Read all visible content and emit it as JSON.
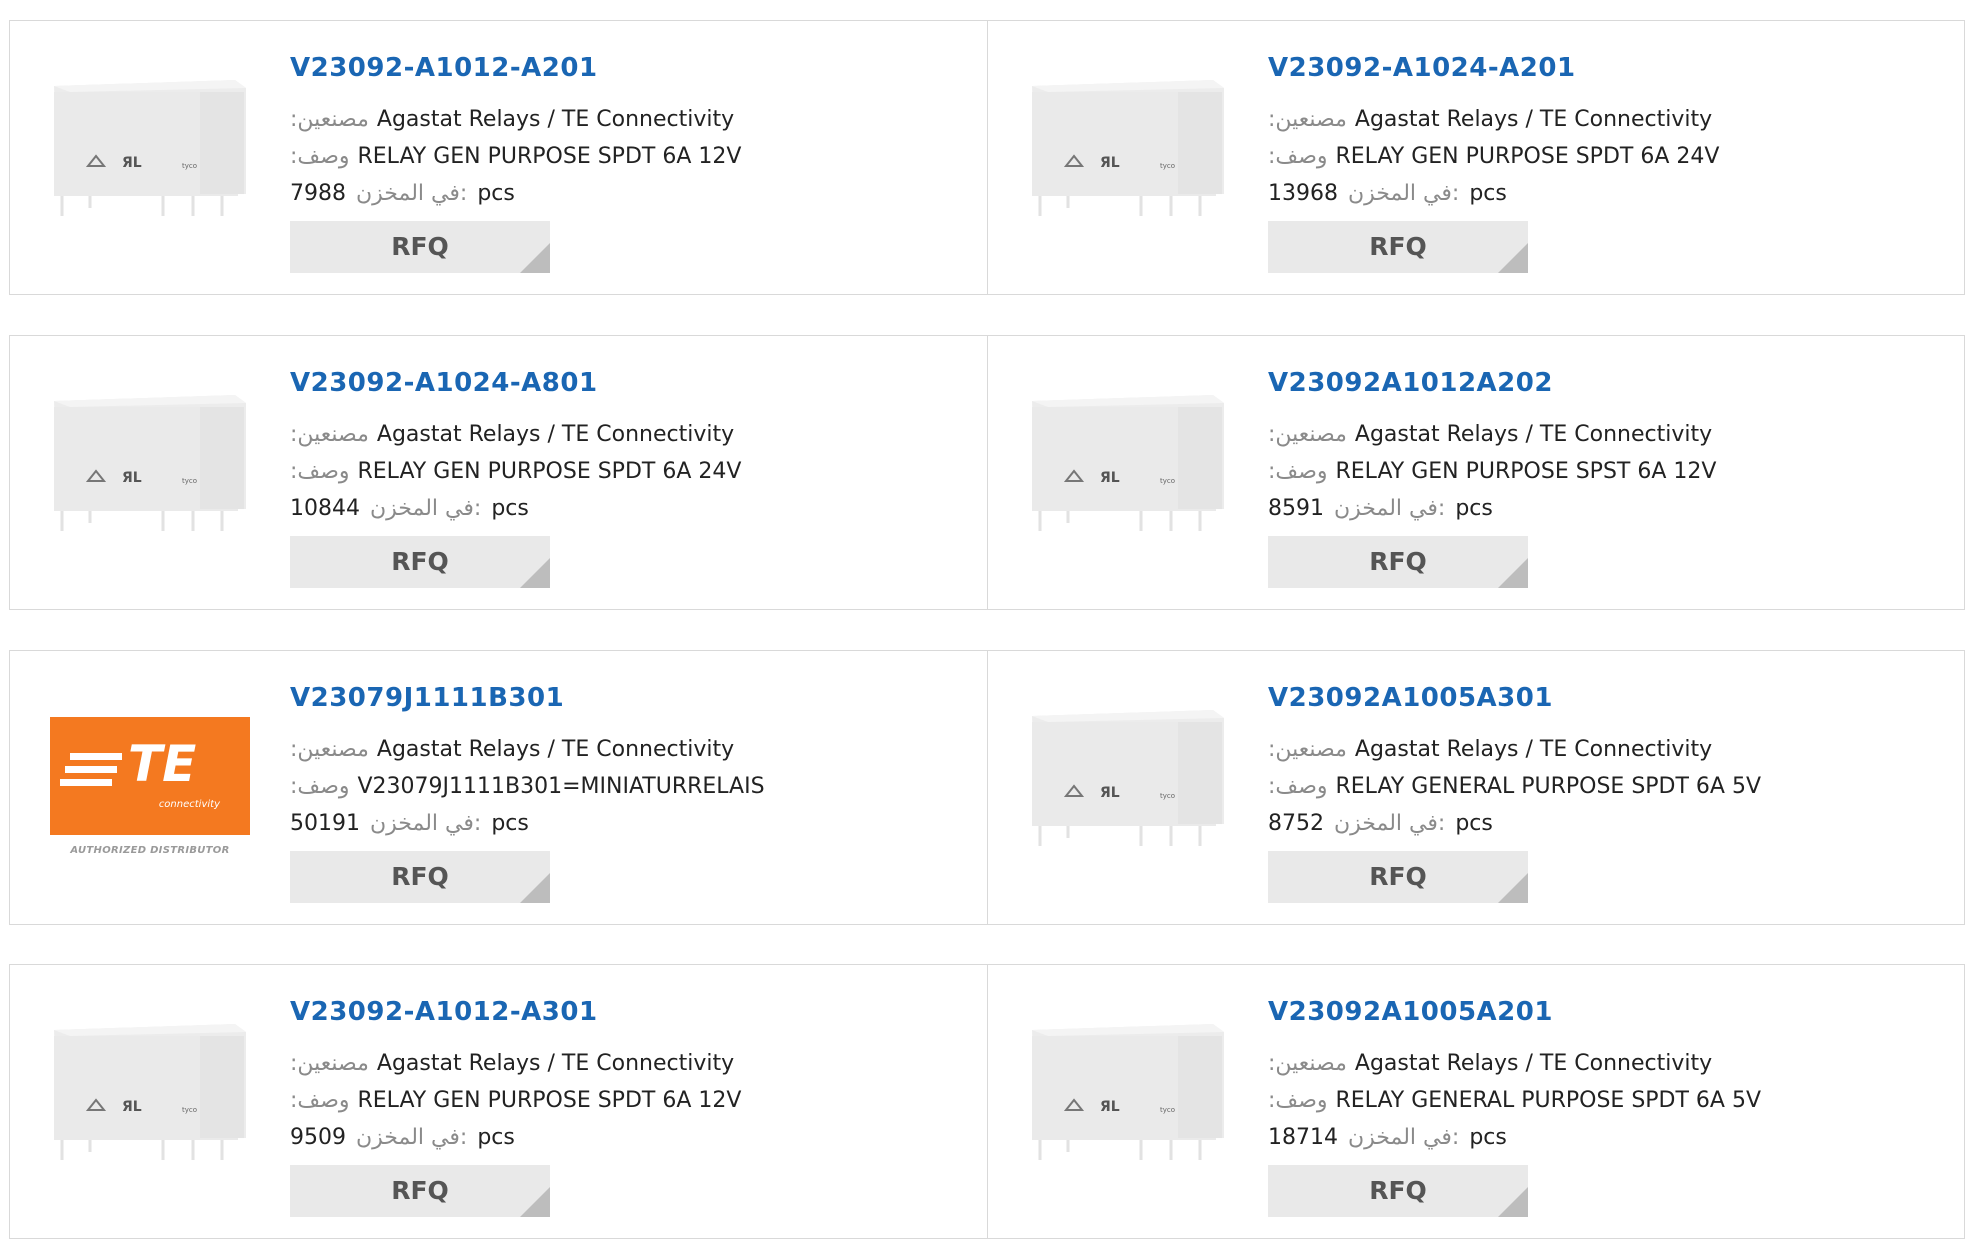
{
  "labels": {
    "manufacturer": ":مصنعين",
    "description": ":وصف",
    "in_stock": "في المخزن:",
    "pcs": "pcs",
    "rfq": "RFQ"
  },
  "te_logo": {
    "text": "TE",
    "sub": "connectivity",
    "tag": "AUTHORIZED DISTRIBUTOR"
  },
  "products": [
    {
      "part": "V23092-A1012-A201",
      "manufacturer": "Agastat Relays / TE Connectivity",
      "description": "RELAY GEN PURPOSE SPDT 6A 12V",
      "stock": "7988",
      "image": "relay"
    },
    {
      "part": "V23092-A1024-A201",
      "manufacturer": "Agastat Relays / TE Connectivity",
      "description": "RELAY GEN PURPOSE SPDT 6A 24V",
      "stock": "13968",
      "image": "relay"
    },
    {
      "part": "V23092-A1024-A801",
      "manufacturer": "Agastat Relays / TE Connectivity",
      "description": "RELAY GEN PURPOSE SPDT 6A 24V",
      "stock": "10844",
      "image": "relay"
    },
    {
      "part": "V23092A1012A202",
      "manufacturer": "Agastat Relays / TE Connectivity",
      "description": "RELAY GEN PURPOSE SPST 6A 12V",
      "stock": "8591",
      "image": "relay"
    },
    {
      "part": "V23079J1111B301",
      "manufacturer": "Agastat Relays / TE Connectivity",
      "description": "V23079J1111B301=MINIATURRELAIS",
      "stock": "50191",
      "image": "te-logo"
    },
    {
      "part": "V23092A1005A301",
      "manufacturer": "Agastat Relays / TE Connectivity",
      "description": "RELAY GENERAL PURPOSE SPDT 6A 5V",
      "stock": "8752",
      "image": "relay"
    },
    {
      "part": "V23092-A1012-A301",
      "manufacturer": "Agastat Relays / TE Connectivity",
      "description": "RELAY GEN PURPOSE SPDT 6A 12V",
      "stock": "9509",
      "image": "relay"
    },
    {
      "part": "V23092A1005A201",
      "manufacturer": "Agastat Relays / TE Connectivity",
      "description": "RELAY GENERAL PURPOSE SPDT 6A 5V",
      "stock": "18714",
      "image": "relay"
    }
  ],
  "colors": {
    "link": "#1a66b3",
    "label": "#8a8a8a",
    "button_bg": "#e9e9e9",
    "te_orange": "#f47920"
  }
}
